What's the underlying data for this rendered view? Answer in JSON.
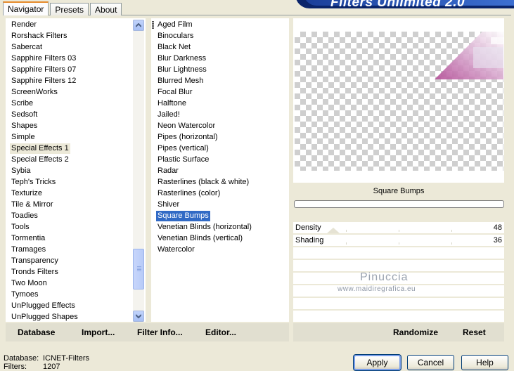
{
  "tabs": [
    {
      "label": "Navigator",
      "active": true
    },
    {
      "label": "Presets",
      "active": false
    },
    {
      "label": "About",
      "active": false
    }
  ],
  "banner_title": "Filters Unlimited 2.0",
  "categories": {
    "items": [
      "Render",
      "Rorshack Filters",
      "Sabercat",
      "Sapphire Filters 03",
      "Sapphire Filters 07",
      "Sapphire Filters 12",
      "ScreenWorks",
      "Scribe",
      "Sedsoft",
      "Shapes",
      "Simple",
      "Special Effects 1",
      "Special Effects 2",
      "Sybia",
      "Teph's Tricks",
      "Texturize",
      "Tile & Mirror",
      "Toadies",
      "Tools",
      "Tormentia",
      "Tramages",
      "Transparency",
      "Tronds Filters",
      "Two Moon",
      "Tymoes",
      "UnPlugged Effects",
      "UnPlugged Shapes"
    ],
    "selected": "Special Effects 1"
  },
  "filters": {
    "items": [
      "Aged Film",
      "Binoculars",
      "Black Net",
      "Blur Darkness",
      "Blur Lightness",
      "Blurred Mesh",
      "Focal Blur",
      "Halftone",
      "Jailed!",
      "Neon Watercolor",
      "Pipes (horizontal)",
      "Pipes (vertical)",
      "Plastic Surface",
      "Radar",
      "Rasterlines (black & white)",
      "Rasterlines (color)",
      "Shiver",
      "Square Bumps",
      "Venetian Blinds (horizontal)",
      "Venetian Blinds (vertical)",
      "Watercolor"
    ],
    "selected": "Square Bumps"
  },
  "left_buttons": {
    "database": "Database",
    "import": "Import...",
    "filter_info": "Filter Info...",
    "editor": "Editor..."
  },
  "filter_name": "Square Bumps",
  "params": [
    {
      "label": "Density",
      "value": "48"
    },
    {
      "label": "Shading",
      "value": "36"
    }
  ],
  "right_buttons": {
    "randomize": "Randomize",
    "reset": "Reset"
  },
  "watermark": {
    "name": "Pinuccia",
    "url": "www.maidiregrafica.eu"
  },
  "footer": {
    "database_label": "Database:",
    "database_value": "ICNET-Filters",
    "filters_label": "Filters:",
    "filters_value": "1207"
  },
  "dialog_buttons": {
    "apply": "Apply",
    "cancel": "Cancel",
    "help": "Help"
  },
  "colors": {
    "selection": "#316ac5",
    "dialog_bg": "#ece9d8",
    "banner": "#0a246a"
  }
}
